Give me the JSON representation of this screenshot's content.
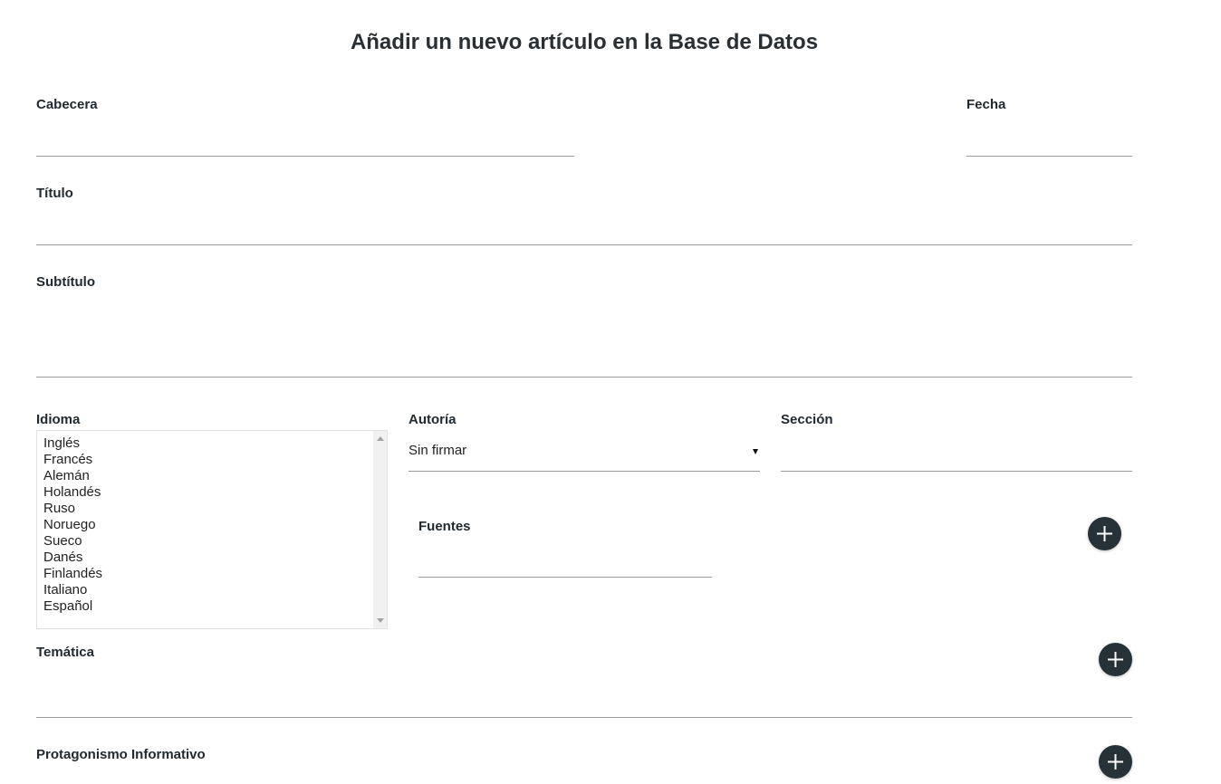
{
  "page_title": "Añadir un nuevo artículo en la Base de Datos",
  "fields": {
    "cabecera": {
      "label": "Cabecera",
      "value": ""
    },
    "fecha": {
      "label": "Fecha",
      "value": ""
    },
    "titulo": {
      "label": "Título",
      "value": ""
    },
    "subtitulo": {
      "label": "Subtítulo",
      "value": ""
    },
    "idioma": {
      "label": "Idioma",
      "options": [
        "Inglés",
        "Francés",
        "Alemán",
        "Holandés",
        "Ruso",
        "Noruego",
        "Sueco",
        "Danés",
        "Finlandés",
        "Italiano",
        "Español"
      ]
    },
    "autoria": {
      "label": "Autoría",
      "selected": "Sin firmar"
    },
    "seccion": {
      "label": "Sección",
      "value": ""
    },
    "fuentes": {
      "label": "Fuentes",
      "value": ""
    },
    "tematica": {
      "label": "Temática",
      "value": ""
    },
    "protagonismo": {
      "label": "Protagonismo Informativo"
    }
  },
  "icons": {
    "add": "plus-icon"
  },
  "colors": {
    "fab_background": "#263238",
    "text": "#222a30",
    "underline": "#9a9a9a"
  }
}
